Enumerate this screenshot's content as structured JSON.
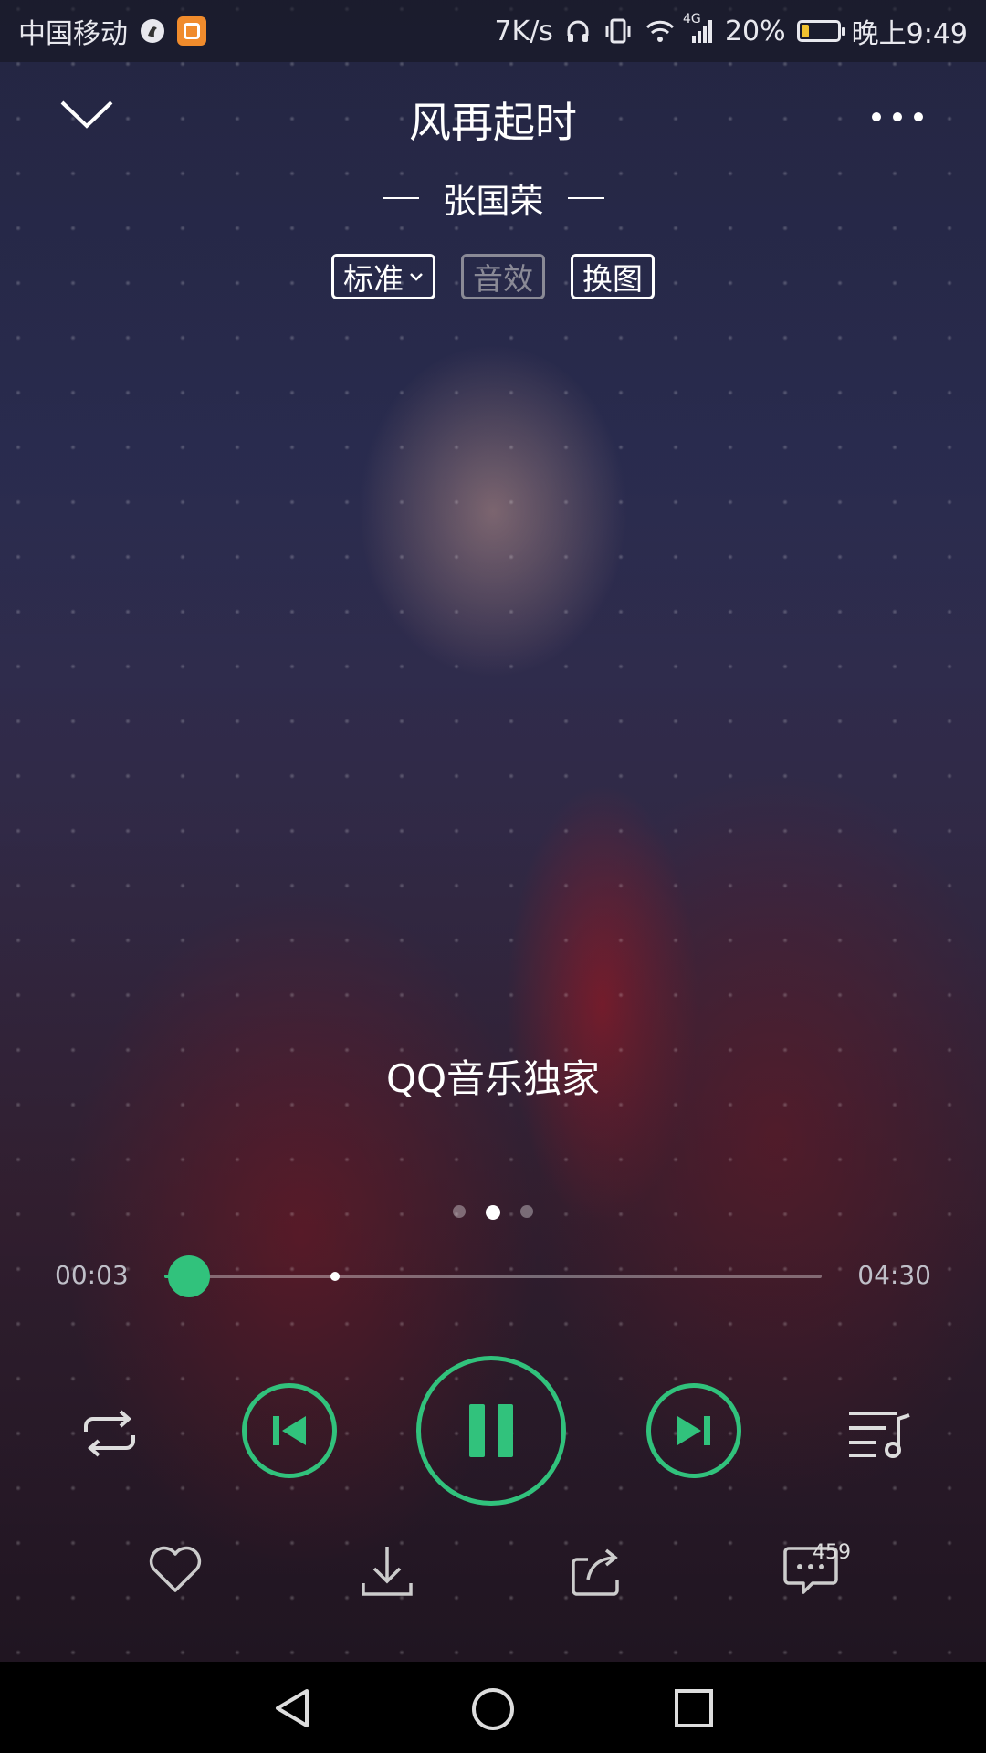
{
  "status_bar": {
    "carrier": "中国移动",
    "speed": "7K/s",
    "network": "4G",
    "battery": "20%",
    "battery_level": 0.2,
    "time": "晚上9:49"
  },
  "header": {
    "song_title": "风再起时",
    "artist": "张国荣"
  },
  "chips": {
    "quality": "标准",
    "effect": "音效",
    "change_image": "换图"
  },
  "lyric": "QQ音乐独家",
  "pager": {
    "count": 3,
    "active": 1
  },
  "progress": {
    "current": "00:03",
    "total": "04:30",
    "played_fraction": 0.037,
    "buffered_fraction": 0.26
  },
  "actions": {
    "comment_count": "459"
  },
  "colors": {
    "accent": "#31c27c",
    "status_bar_bg": "#14141e",
    "nav_bar_bg": "#000000"
  },
  "icons": {
    "collapse": "chevron-down-icon",
    "more": "more-dots-icon",
    "repeat": "repeat-icon",
    "previous": "previous-track-icon",
    "pause": "pause-icon",
    "next": "next-track-icon",
    "playlist": "playlist-icon",
    "like": "heart-icon",
    "download": "download-icon",
    "share": "share-icon",
    "comment": "comment-icon"
  }
}
